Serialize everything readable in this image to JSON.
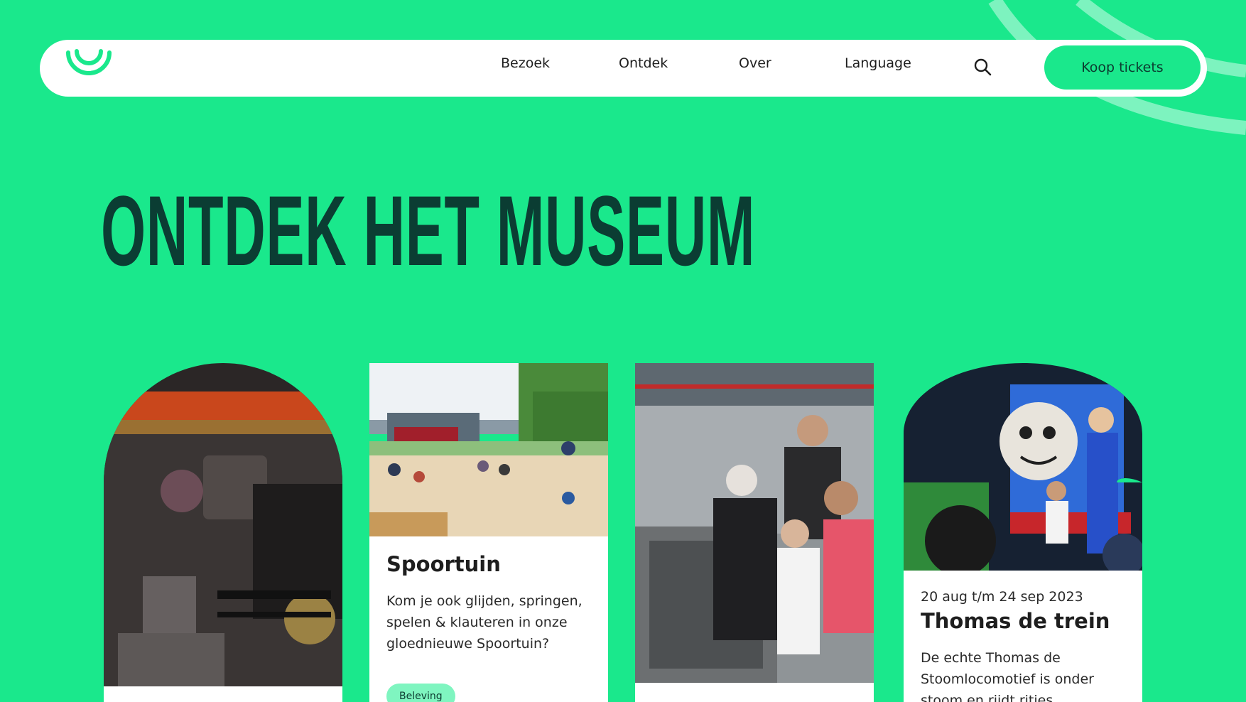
{
  "brand": {
    "accent": "#1ae88c",
    "dark": "#0b3d33",
    "tag_bg": "#7ff5c0"
  },
  "header": {
    "logo_icon": "smile-arc-logo",
    "nav": [
      {
        "label": "Bezoek"
      },
      {
        "label": "Ontdek"
      },
      {
        "label": "Over"
      },
      {
        "label": "Language"
      }
    ],
    "search_icon": "search-icon",
    "cta_label": "Koop tickets"
  },
  "hero": {
    "title": "ONTDEK HET MUSEUM"
  },
  "cards": [
    {
      "image": "photo-indoor-locomotive-ride",
      "title": "",
      "text": "",
      "tag": ""
    },
    {
      "image": "photo-playground-spoortuin",
      "title": "Spoortuin",
      "text": "Kom je ook glijden, springen, spelen & klauteren in onze gloednieuwe Spoortuin?",
      "tag": "Beleving"
    },
    {
      "image": "photo-engine-machinist",
      "title": "",
      "text": "",
      "tag": ""
    },
    {
      "image": "photo-thomas-the-train",
      "date": "20 aug t/m 24 sep 2023",
      "title": "Thomas de trein",
      "text": "De echte Thomas de Stoomlocomotief is onder stoom en rijdt ritjes"
    }
  ]
}
